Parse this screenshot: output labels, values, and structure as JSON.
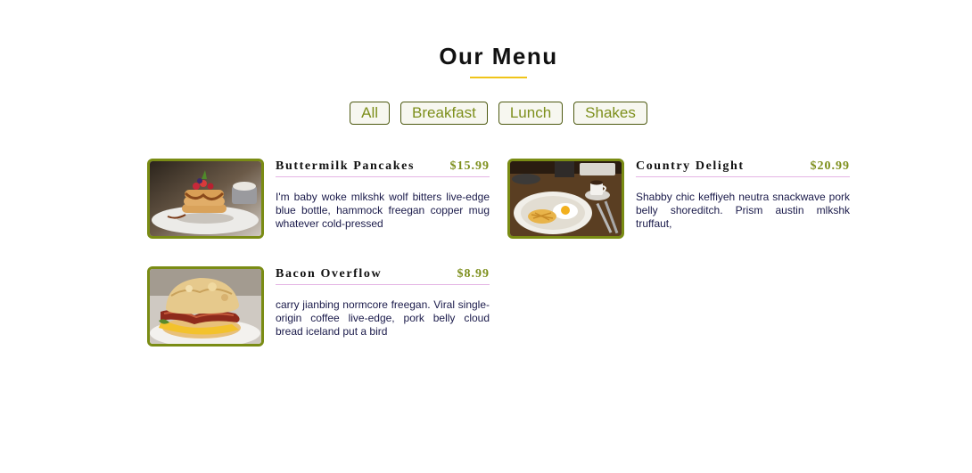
{
  "menu": {
    "title": "Our Menu",
    "accent_color": "#f0c419",
    "filters": [
      {
        "label": "All"
      },
      {
        "label": "Breakfast"
      },
      {
        "label": "Lunch"
      },
      {
        "label": "Shakes"
      }
    ],
    "items": [
      {
        "name": "Buttermilk Pancakes",
        "price": "$15.99",
        "description": "I'm baby woke mlkshk wolf bitters live-edge blue bottle, hammock freegan copper mug whatever cold-pressed",
        "image": "buttermilk-pancakes-photo"
      },
      {
        "name": "Country Delight",
        "price": "$20.99",
        "description": "Shabby chic keffiyeh neutra snackwave pork belly shoreditch. Prism austin mlkshk truffaut,",
        "image": "country-delight-photo"
      },
      {
        "name": "Bacon Overflow",
        "price": "$8.99",
        "description": "carry jianbing normcore freegan. Viral single-origin coffee live-edge, pork belly cloud bread iceland put a bird",
        "image": "bacon-overflow-photo"
      }
    ]
  }
}
